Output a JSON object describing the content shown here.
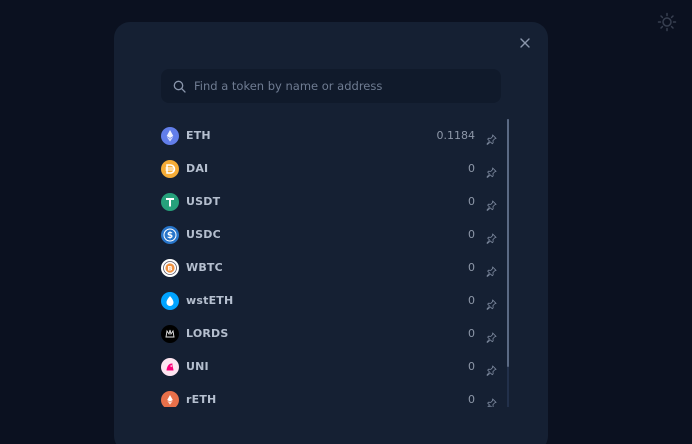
{
  "modal": {
    "search": {
      "placeholder": "Find a token by name or address"
    },
    "tokens": [
      {
        "symbol": "ETH",
        "balance": "0.1184",
        "icon": "eth-icon",
        "color": "#627eea"
      },
      {
        "symbol": "DAI",
        "balance": "0",
        "icon": "dai-icon",
        "color": "#f5ac37"
      },
      {
        "symbol": "USDT",
        "balance": "0",
        "icon": "usdt-icon",
        "color": "#26a17b"
      },
      {
        "symbol": "USDC",
        "balance": "0",
        "icon": "usdc-icon",
        "color": "#2775ca"
      },
      {
        "symbol": "WBTC",
        "balance": "0",
        "icon": "wbtc-icon",
        "color": "#f09242"
      },
      {
        "symbol": "wstETH",
        "balance": "0",
        "icon": "wsteth-icon",
        "color": "#00a3ff"
      },
      {
        "symbol": "LORDS",
        "balance": "0",
        "icon": "lords-icon",
        "color": "#000000"
      },
      {
        "symbol": "UNI",
        "balance": "0",
        "icon": "uni-icon",
        "color": "#ff007a"
      },
      {
        "symbol": "rETH",
        "balance": "0",
        "icon": "reth-icon",
        "color": "#e8704a"
      }
    ]
  },
  "colors": {
    "background": "#0b1120",
    "modal": "#152033",
    "search_bg": "#101a2b"
  }
}
